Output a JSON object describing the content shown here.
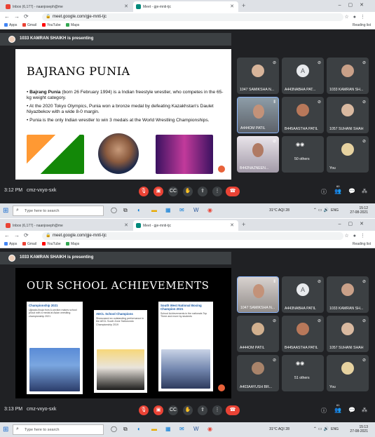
{
  "colors": {
    "accent": "#ea4335",
    "meet_bg": "#202124",
    "tile_bg": "#3c4043",
    "active_border": "#8ab4f8"
  },
  "shots": [
    {
      "tabs": [
        {
          "label": "Inbox (6,177) - naanjoseph@me"
        },
        {
          "label": "Meet - gje-mnti-tjc"
        }
      ],
      "url": "meet.google.com/gje-mnti-tjc",
      "bookmarks": {
        "apps": "Apps",
        "gmail": "Gmail",
        "youtube": "YouTube",
        "maps": "Maps",
        "reading": "Reading list"
      },
      "presenter": "1033 KAMRAN SHAIKH is presenting",
      "slide": {
        "title": "BAJRANG PUNIA",
        "bullets": [
          {
            "bold": "Bajrang Punia",
            "text": " (born 26 February 1994) is a Indian freestyle wrestler, who competes in the 65-kg weight category."
          },
          {
            "bold": "",
            "text": "At the 2020 Tokyo Olympics, Punia won a bronze medal by defeating Kazakhstan's Daulet Niyazbekov with a wide 8-0 margin."
          },
          {
            "bold": "",
            "text": "Punia is the only Indian wrestler to win 3 medals at the World Wrestling Championships."
          }
        ]
      },
      "tiles": [
        {
          "name": "1047 SAMIKSHA N...",
          "kind": "face"
        },
        {
          "name": "A443NABHA PAT...",
          "kind": "initial",
          "initial": "A"
        },
        {
          "name": "1033 KAMRAN SH...",
          "kind": "face"
        },
        {
          "name": "A444OM PATIL",
          "kind": "video"
        },
        {
          "name": "B445AASTHA PATIL",
          "kind": "face"
        },
        {
          "name": "1057 SUHANI SHAH",
          "kind": "face"
        },
        {
          "name": "B442NAZNEEN...",
          "kind": "video"
        },
        {
          "name": "50 others",
          "kind": "others"
        },
        {
          "name": "You",
          "kind": "face"
        }
      ],
      "time": "3:12 PM",
      "meeting_code": "cmz-vxyo-sxk",
      "participants_count": "60",
      "taskbar": {
        "search": "Type here to search",
        "weather": "31°C  AQI 28",
        "lang": "ENG",
        "clock_time": "15:12",
        "clock_date": "27-08-2021"
      }
    },
    {
      "tabs": [
        {
          "label": "Inbox (6,177) - naanjoseph@me"
        },
        {
          "label": "Meet - gje-mnti-tjc"
        }
      ],
      "url": "meet.google.com/gje-mnti-tjc",
      "bookmarks": {
        "apps": "Apps",
        "gmail": "Gmail",
        "youtube": "YouTube",
        "maps": "Maps",
        "reading": "Reading list"
      },
      "presenter": "1033 KAMRAN SHAIKH is presenting",
      "slide": {
        "title": "OUR SCHOOL ACHIEVEMENTS",
        "cards": [
          {
            "title": "Championship 2021",
            "body": "Ujjwala Ahuja from A-section makes school proud with a medal at Asian wrestling championship 2021"
          },
          {
            "title": "AECL School Champions",
            "body": "Showcased an outstanding performance in the AECL South Zone Taekwondo Championship 2019"
          },
          {
            "title": "South West National Boxing Champion 2021",
            "body": "School Achievements in the nationals Top Three and more by students"
          }
        ]
      },
      "tiles": [
        {
          "name": "1047 SAMIKSHA N...",
          "kind": "video"
        },
        {
          "name": "A443NABHA PATIL",
          "kind": "initial",
          "initial": "A"
        },
        {
          "name": "1033 KAMRAN SH...",
          "kind": "face"
        },
        {
          "name": "A444OM PATIL",
          "kind": "face"
        },
        {
          "name": "B445AASTHA PATIL",
          "kind": "face"
        },
        {
          "name": "1057 SUHANI SHAH",
          "kind": "face"
        },
        {
          "name": "A403AAYUSH BR...",
          "kind": "face"
        },
        {
          "name": "51 others",
          "kind": "others"
        },
        {
          "name": "You",
          "kind": "face"
        }
      ],
      "time": "3:13 PM",
      "meeting_code": "cmz-vxyo-sxk",
      "participants_count": "61",
      "taskbar": {
        "search": "Type here to search",
        "weather": "31°C  AQI 28",
        "lang": "ENG",
        "clock_time": "15:13",
        "clock_date": "27-08-2021"
      }
    }
  ]
}
